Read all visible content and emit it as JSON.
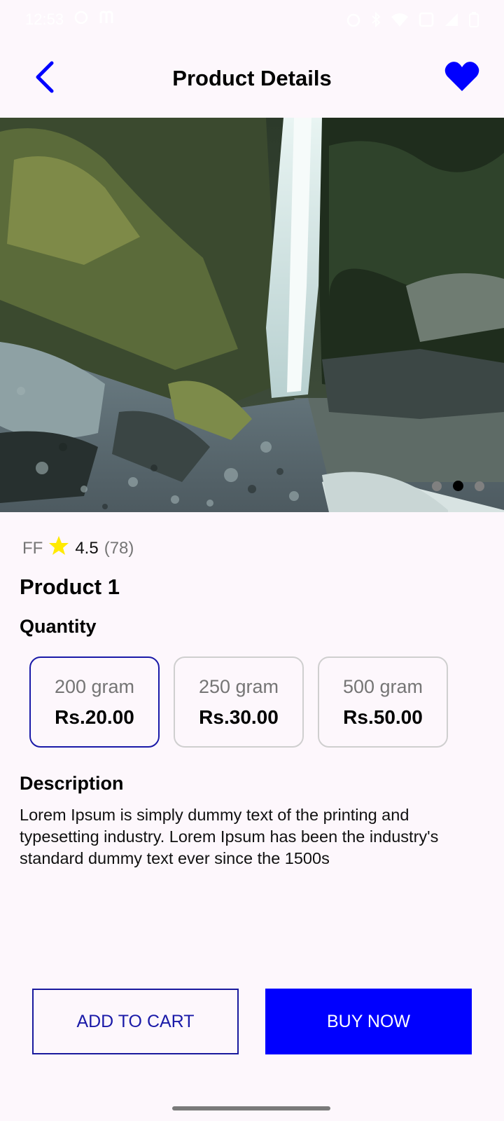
{
  "status_bar": {
    "time": "12:53"
  },
  "app_bar": {
    "title": "Product Details",
    "back_icon": "chevron-left-icon",
    "favorite_icon": "heart-icon"
  },
  "carousel": {
    "slide_count": 3,
    "active_index": 1
  },
  "product": {
    "brand": "FF",
    "rating": "4.5",
    "review_count": "(78)",
    "name": "Product 1"
  },
  "quantity": {
    "label": "Quantity",
    "options": [
      {
        "weight": "200 gram",
        "price": "Rs.20.00",
        "selected": true
      },
      {
        "weight": "250 gram",
        "price": "Rs.30.00",
        "selected": false
      },
      {
        "weight": "500 gram",
        "price": "Rs.50.00",
        "selected": false
      }
    ]
  },
  "description": {
    "label": "Description",
    "text": "Lorem Ipsum is simply dummy text of the printing and typesetting industry. Lorem Ipsum has been the industry's standard dummy text ever since the 1500s"
  },
  "actions": {
    "add_to_cart": "ADD TO CART",
    "buy_now": "BUY NOW"
  },
  "colors": {
    "accent": "#0000ff",
    "accent_dark": "#1a1aa8",
    "star": "#ffea00",
    "background": "#fdf7fc"
  }
}
